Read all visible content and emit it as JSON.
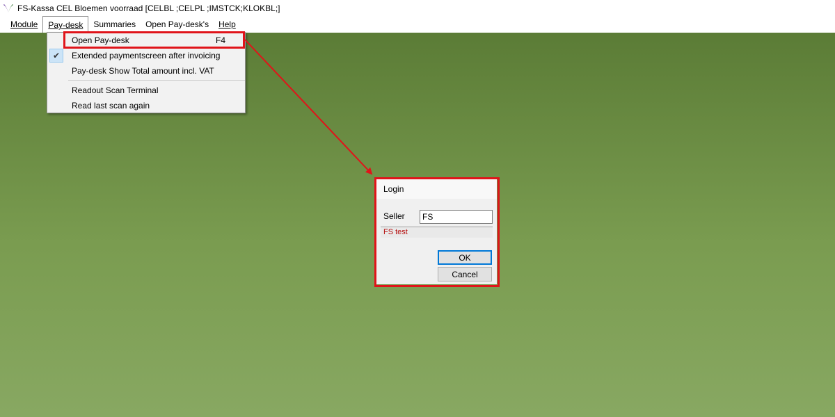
{
  "window": {
    "title": "FS-Kassa CEL Bloemen voorraad [CELBL ;CELPL ;IMSTCK;KLOKBL;]",
    "logo_icon": "fs-kassa-logo-icon"
  },
  "menubar": {
    "items": [
      {
        "label": "Module"
      },
      {
        "label": "Pay-desk"
      },
      {
        "label": "Summaries"
      },
      {
        "label": "Open Pay-desk's"
      },
      {
        "label": "Help"
      }
    ]
  },
  "paydesk_menu": {
    "items": [
      {
        "label": "Open Pay-desk",
        "shortcut": "F4"
      },
      {
        "label": "Extended paymentscreen after invoicing",
        "checked": true
      },
      {
        "label": "Pay-desk Show Total amount incl. VAT"
      },
      {
        "label": "Readout Scan Terminal"
      },
      {
        "label": "Read last scan again"
      }
    ]
  },
  "login_dialog": {
    "title": "Login",
    "seller_label": "Seller",
    "seller_value": "FS",
    "status_text": "FS test",
    "ok_label": "OK",
    "cancel_label": "Cancel"
  },
  "colors": {
    "annotation": "#e0141a",
    "background_top": "#5b7c36",
    "background_bottom": "#88a862",
    "status_text": "#b50f0f",
    "focus_border": "#0078d7"
  }
}
